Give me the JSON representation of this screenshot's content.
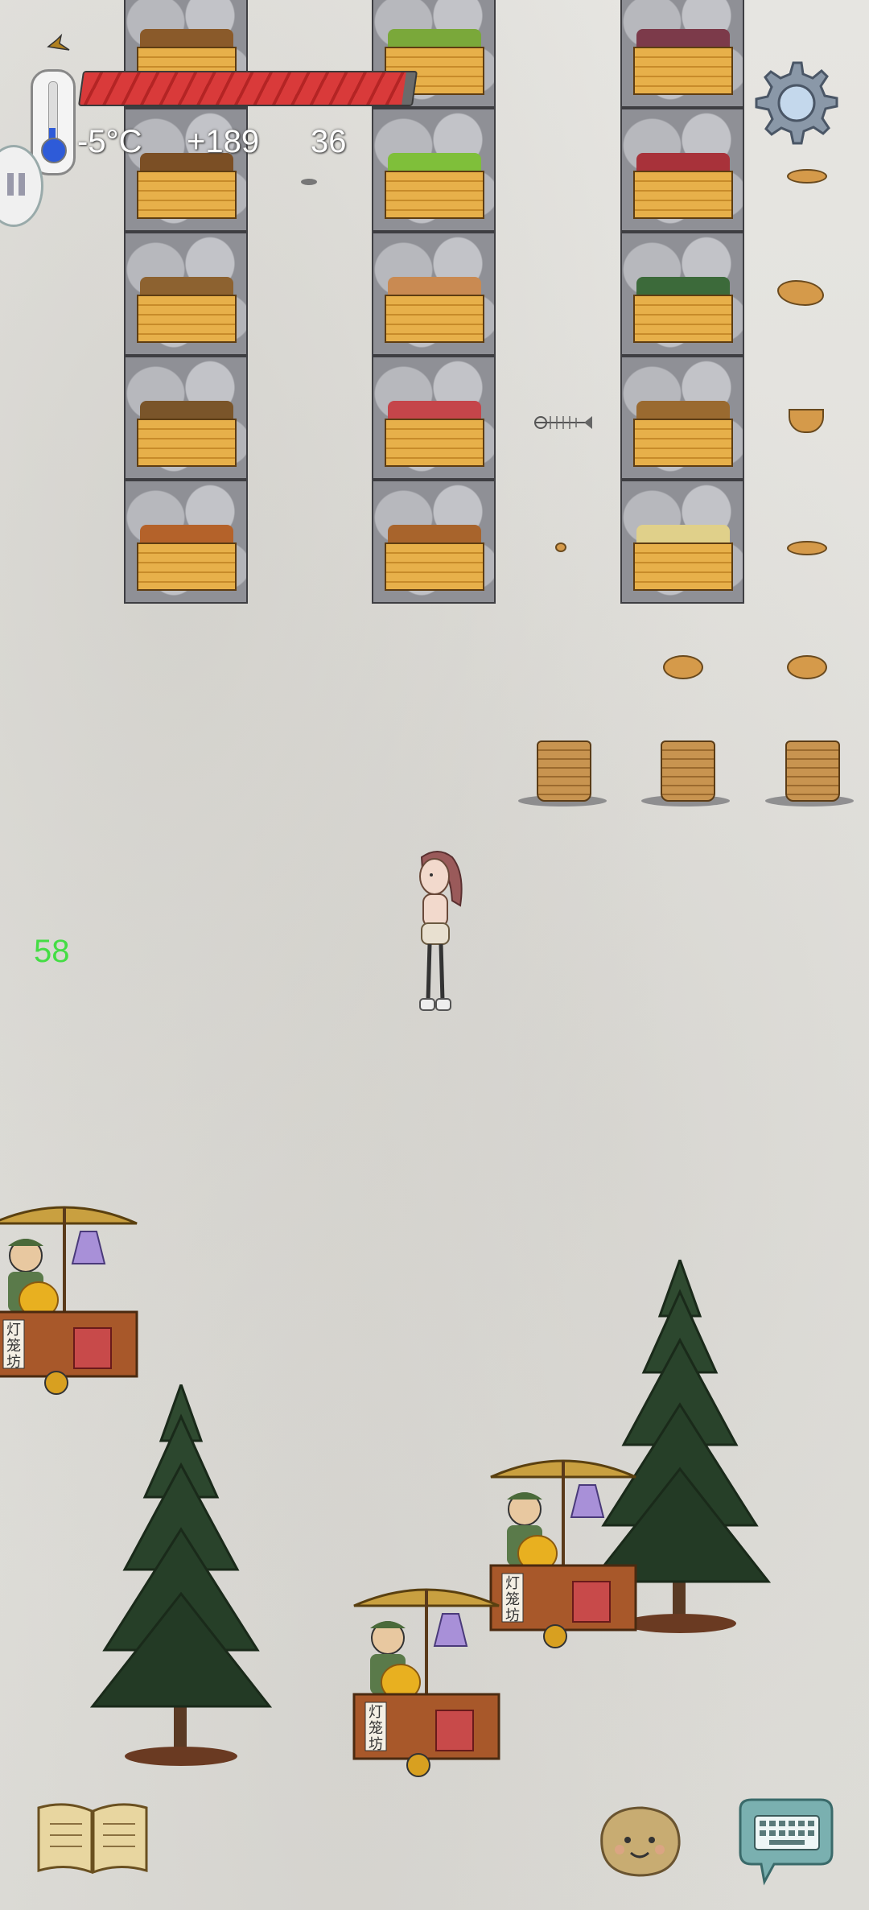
{
  "hud": {
    "temperature": "-5°C",
    "delta": "+189",
    "value": "36",
    "fps": "58",
    "health": 0.97
  },
  "icons": {
    "thermometer": "thermometer-icon",
    "settings": "gear-icon",
    "pause": "pause-icon",
    "journal": "open-book-icon",
    "emote": "potato-face-icon",
    "chat": "keyboard-chat-icon"
  },
  "stalls": [
    {
      "sign": "灯笼坊"
    },
    {
      "sign": "灯笼坊"
    },
    {
      "sign": "灯笼坊"
    }
  ],
  "colors": {
    "health": "#d93a3a",
    "fps": "#44dd44",
    "mercury": "#2e5bd8"
  }
}
